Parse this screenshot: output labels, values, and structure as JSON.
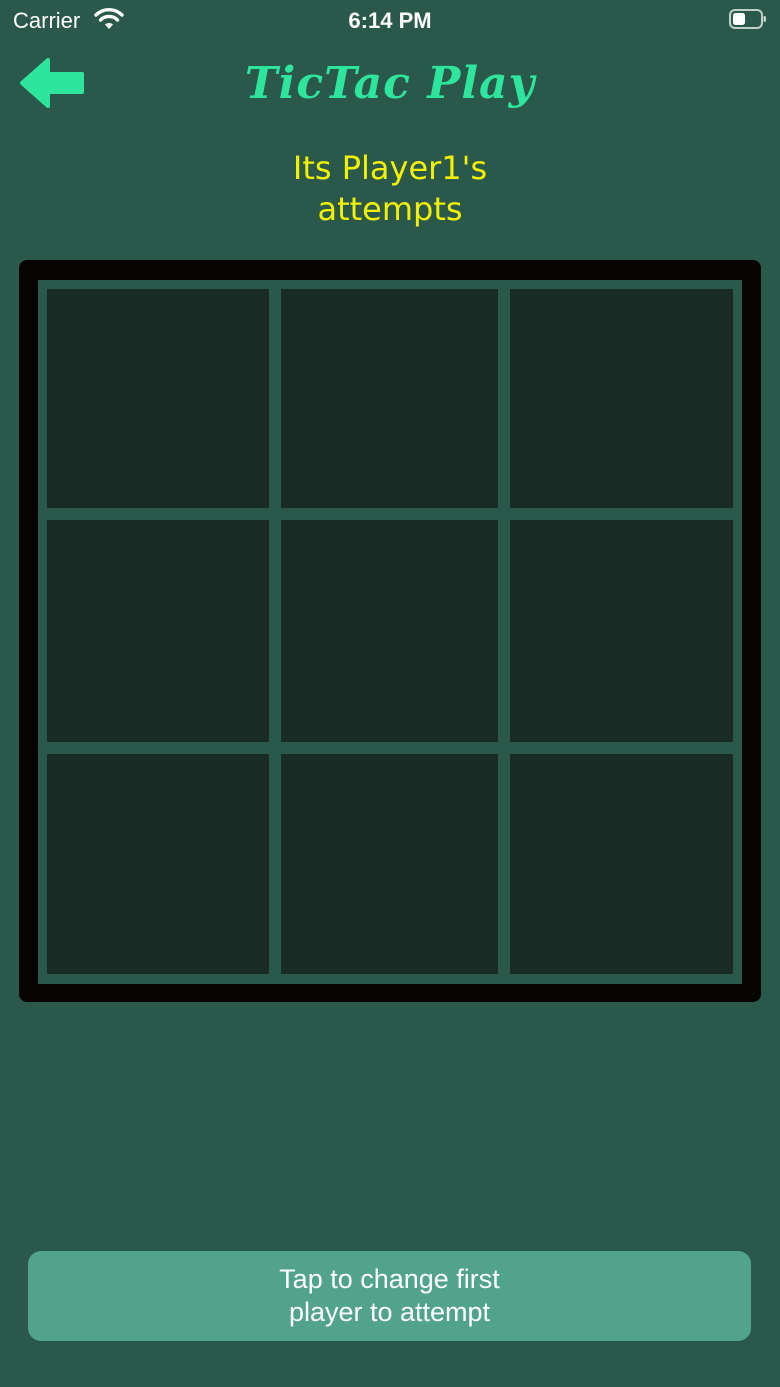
{
  "status_bar": {
    "carrier": "Carrier",
    "time": "6:14 PM",
    "wifi_icon": "wifi-icon",
    "battery_icon": "battery-icon"
  },
  "header": {
    "back_icon": "arrow-left-icon",
    "title": "TicTac Play",
    "title_color": "#2ee59d"
  },
  "turn": {
    "text": "Its Player1's attempts",
    "color": "#f2f200"
  },
  "board": {
    "rows": 3,
    "cols": 3,
    "cells": [
      "",
      "",
      "",
      "",
      "",
      "",
      "",
      "",
      ""
    ],
    "frame_color": "#060303",
    "cell_color": "#182c25"
  },
  "footer": {
    "button_label": "Tap to change first player to attempt",
    "button_color": "#52a38c"
  },
  "colors": {
    "background": "#2a584b"
  }
}
